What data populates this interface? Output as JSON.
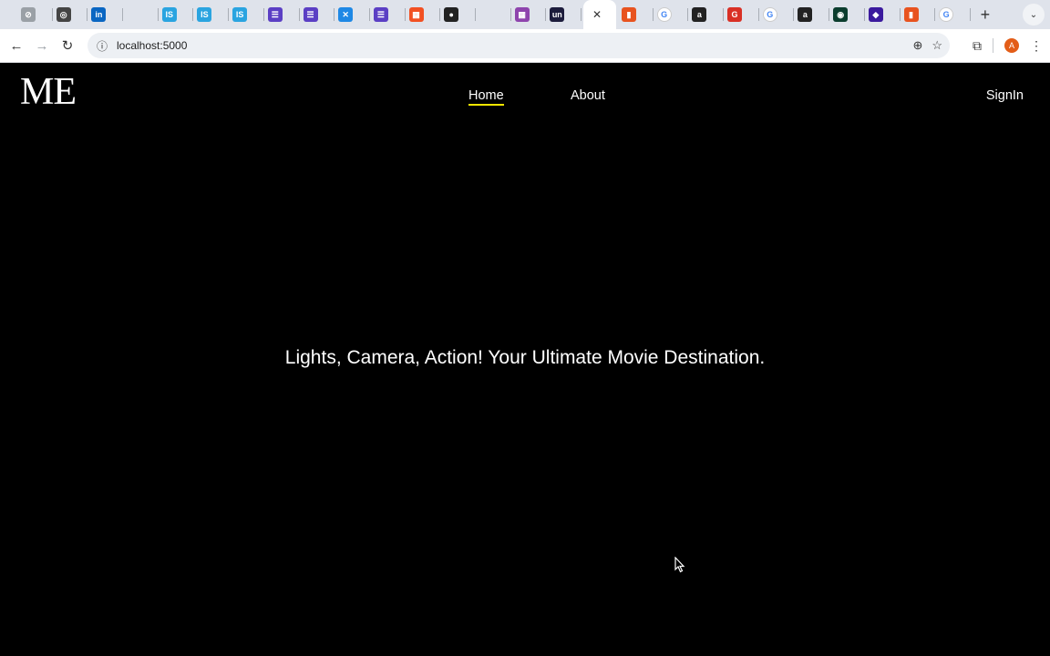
{
  "browser": {
    "tabs": [
      {
        "icon": "generic-icon",
        "color": "#9aa0a6",
        "glyph": "⊘"
      },
      {
        "icon": "chatgpt-icon",
        "color": "#444444",
        "glyph": "◎"
      },
      {
        "icon": "linkedin-icon",
        "color": "#0a66c2",
        "glyph": "in"
      },
      {
        "icon": "blank-icon",
        "color": "#dfe3eb",
        "glyph": ""
      },
      {
        "icon": "is-icon",
        "color": "#2aa4e0",
        "glyph": "IS"
      },
      {
        "icon": "is-icon",
        "color": "#2aa4e0",
        "glyph": "IS"
      },
      {
        "icon": "is-icon",
        "color": "#2aa4e0",
        "glyph": "IS"
      },
      {
        "icon": "list-icon",
        "color": "#5b3fc4",
        "glyph": "☰"
      },
      {
        "icon": "list-icon",
        "color": "#5b3fc4",
        "glyph": "☰"
      },
      {
        "icon": "vscode-icon",
        "color": "#1e88e5",
        "glyph": "✕"
      },
      {
        "icon": "list-icon",
        "color": "#5b3fc4",
        "glyph": "☰"
      },
      {
        "icon": "microsoft-icon",
        "color": "#f25022",
        "glyph": "▦"
      },
      {
        "icon": "github-icon",
        "color": "#222222",
        "glyph": "●"
      },
      {
        "icon": "blank-icon",
        "color": "#dfe3eb",
        "glyph": ""
      },
      {
        "icon": "grid-icon",
        "color": "#8e44ad",
        "glyph": "▦"
      },
      {
        "icon": "un-icon",
        "color": "#1c1c3c",
        "glyph": "un"
      }
    ],
    "tabs_after": [
      {
        "icon": "bookmark-icon",
        "color": "#e8531f",
        "glyph": "▮"
      },
      {
        "icon": "google-icon",
        "color": "#ffffff",
        "glyph": "G"
      },
      {
        "icon": "amazon-icon",
        "color": "#222222",
        "glyph": "a"
      },
      {
        "icon": "g-icon",
        "color": "#d93025",
        "glyph": "G"
      },
      {
        "icon": "google-icon",
        "color": "#ffffff",
        "glyph": "G"
      },
      {
        "icon": "amazon-icon",
        "color": "#222222",
        "glyph": "a"
      },
      {
        "icon": "leaf-icon",
        "color": "#0b3d2e",
        "glyph": "◉"
      },
      {
        "icon": "diamond-icon",
        "color": "#3b1a9e",
        "glyph": "◆"
      },
      {
        "icon": "bookmark-icon",
        "color": "#e8531f",
        "glyph": "▮"
      },
      {
        "icon": "google-icon",
        "color": "#ffffff",
        "glyph": "G"
      }
    ],
    "url": "localhost:5000",
    "profile_initial": "A"
  },
  "site": {
    "logo": "ME",
    "nav": {
      "home": "Home",
      "about": "About",
      "signin": "SignIn"
    },
    "hero_text": "Lights, Camera, Action! Your Ultimate Movie Destination.",
    "accent_color": "#f2e600"
  }
}
